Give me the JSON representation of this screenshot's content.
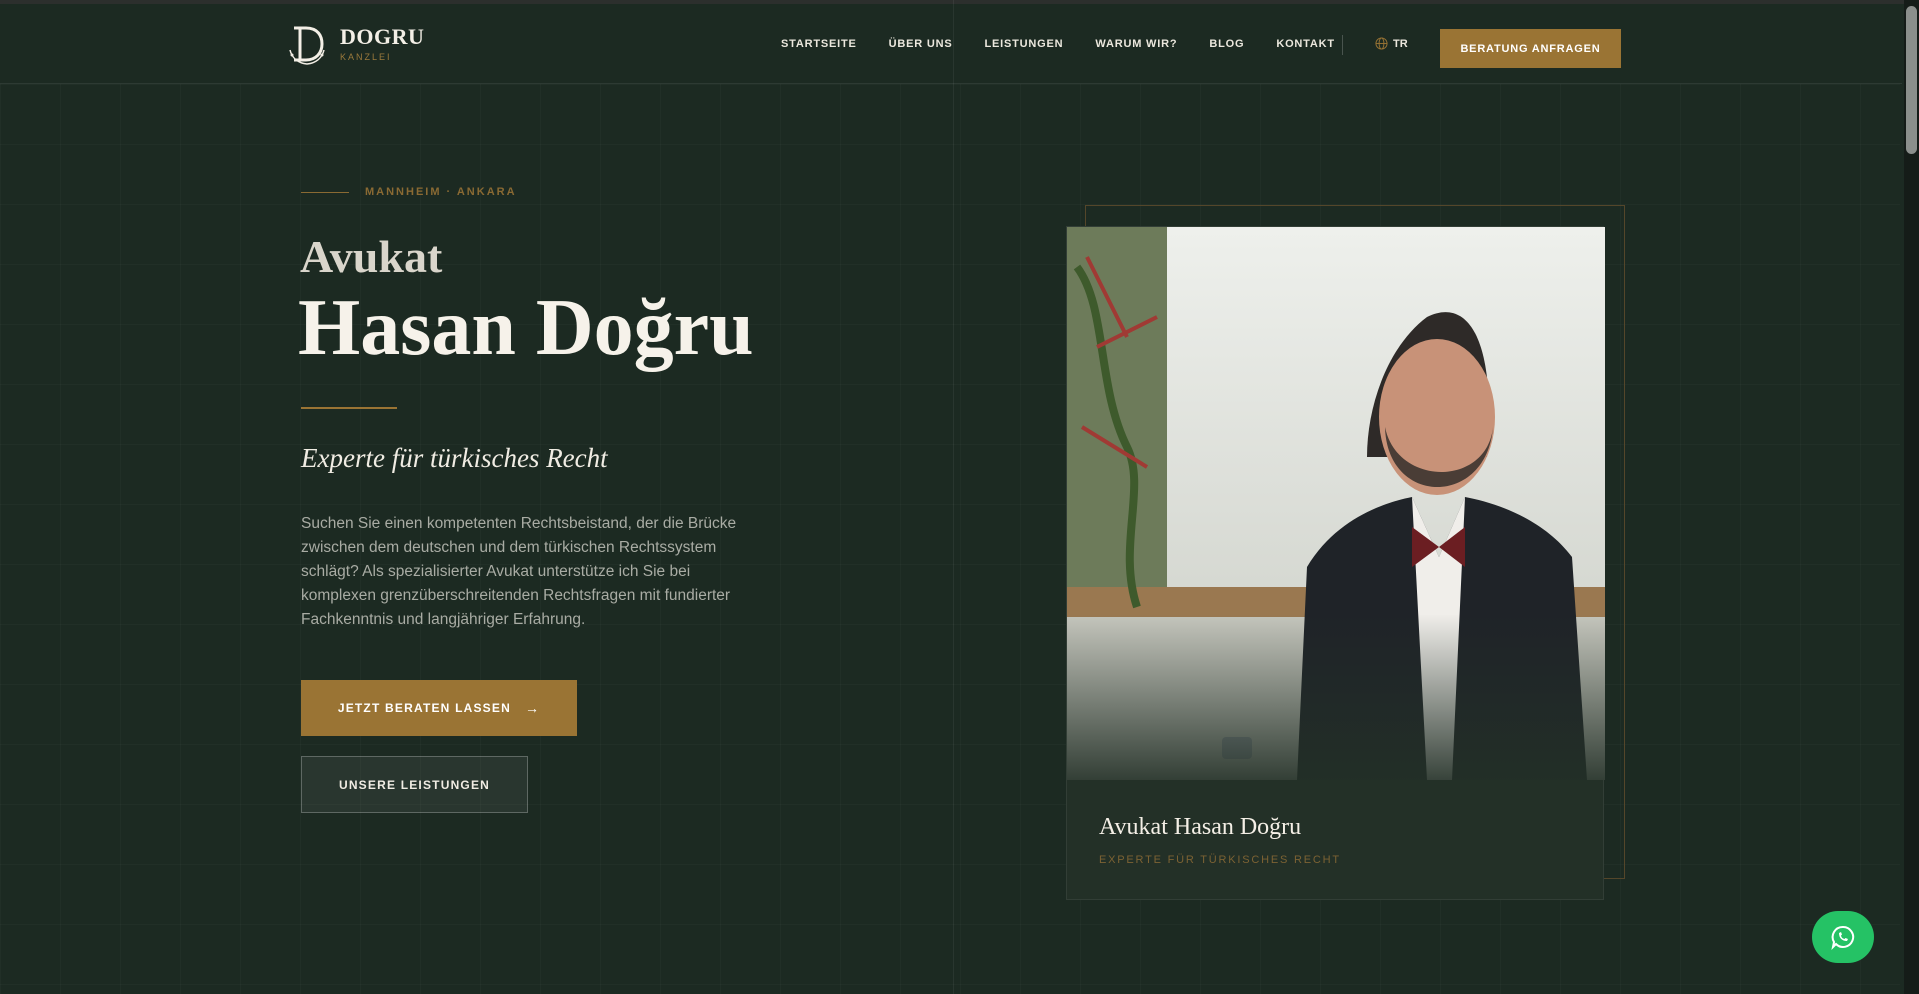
{
  "header": {
    "logo_name": "DOGRU",
    "logo_sub": "KANZLEI",
    "nav": [
      "STARTSEITE",
      "ÜBER UNS",
      "LEISTUNGEN",
      "WARUM WIR?",
      "BLOG",
      "KONTAKT"
    ],
    "lang": "TR",
    "cta": "BERATUNG ANFRAGEN"
  },
  "hero": {
    "eyebrow": "MANNHEIM · ANKARA",
    "title_small": "Avukat",
    "title_big": "Hasan Doğru",
    "subtitle": "Experte für türkisches Recht",
    "intro": "Suchen Sie einen kompetenten Rechtsbeistand, der die Brücke zwischen dem deutschen und dem türkischen Rechtssystem schlägt? Als spezialisierter Avukat unterstütze ich Sie bei komplexen grenzüberschreitenden Rechtsfragen mit fundierter Fachkenntnis und langjähriger Erfahrung.",
    "primary_button": "JETZT BERATEN LASSEN",
    "secondary_button": "UNSERE LEISTUNGEN"
  },
  "card": {
    "name": "Avukat Hasan Doğru",
    "role": "EXPERTE FÜR TÜRKISCHES RECHT"
  },
  "colors": {
    "background": "#1c2a22",
    "gold": "#9a7434",
    "whatsapp": "#25c265"
  },
  "icons": [
    "logo-monogram-icon",
    "globe-icon",
    "arrow-right-icon",
    "whatsapp-icon"
  ]
}
